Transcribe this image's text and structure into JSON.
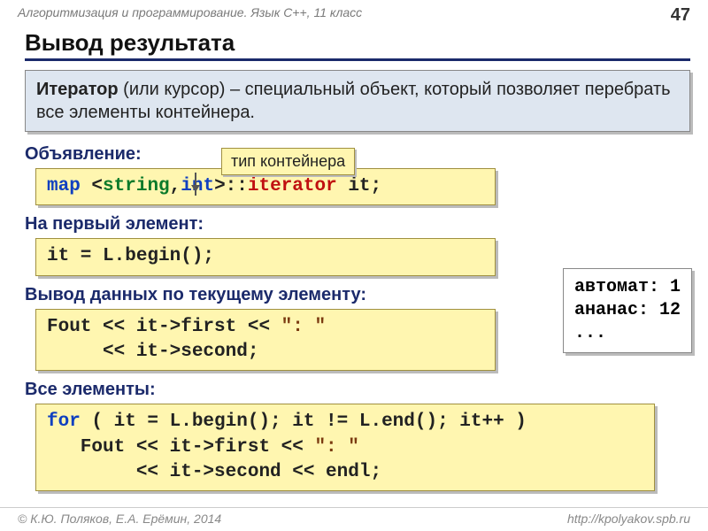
{
  "header": {
    "course": "Алгоритмизация и программирование. Язык C++, 11 класс",
    "page": "47"
  },
  "title": "Вывод результата",
  "definition_bold": "Итератор",
  "definition_rest": " (или курсор) – специальный объект, который позволяет перебрать все элементы контейнера.",
  "labels": {
    "decl": "Объявление:",
    "first": "На первый элемент:",
    "cur": "Вывод данных по текущему элементу:",
    "all": "Все элементы:"
  },
  "callout": "тип контейнера",
  "code": {
    "decl_map": "map",
    "decl_open": " <",
    "decl_string": "string",
    "decl_comma": ",",
    "decl_int": "int",
    "decl_close": ">::",
    "decl_iterator": "iterator",
    "decl_it": " it;",
    "begin": "it = L.begin();",
    "cur1": "Fout << it->first << ",
    "cur_str": "\": \"",
    "cur2": "\n     << it->second;",
    "all_for": "for",
    "all_rest1": " ( it = L.begin(); it != L.end(); it++ )",
    "all_line2a": "\n   Fout << it->first << ",
    "all_str": "\": \"",
    "all_line3": "\n        << it->second << endl;"
  },
  "output": "автомат: 1\nананас: 12\n...",
  "footer": {
    "left": "© К.Ю. Поляков, Е.А. Ерёмин, 2014",
    "right": "http://kpolyakov.spb.ru"
  }
}
